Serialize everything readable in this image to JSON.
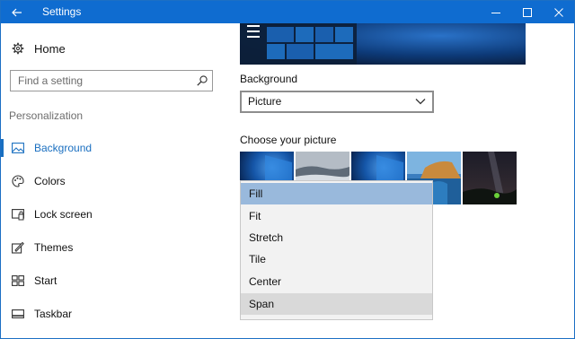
{
  "titlebar": {
    "title": "Settings",
    "back_icon": "back-arrow-icon",
    "minimize_icon": "minimize-icon",
    "maximize_icon": "maximize-icon",
    "close_icon": "close-icon",
    "color": "#0f6cd0"
  },
  "sidebar": {
    "home_label": "Home",
    "search_placeholder": "Find a setting",
    "section_label": "Personalization",
    "items": [
      {
        "label": "Background",
        "icon": "picture-icon",
        "active": true
      },
      {
        "label": "Colors",
        "icon": "palette-icon",
        "active": false
      },
      {
        "label": "Lock screen",
        "icon": "lock-screen-icon",
        "active": false
      },
      {
        "label": "Themes",
        "icon": "themes-icon",
        "active": false
      },
      {
        "label": "Start",
        "icon": "start-icon",
        "active": false
      },
      {
        "label": "Taskbar",
        "icon": "taskbar-icon",
        "active": false
      }
    ],
    "accent": "#1a6fc0"
  },
  "main": {
    "background_label": "Background",
    "background_value": "Picture",
    "choose_label": "Choose your picture"
  },
  "fit_dropdown": {
    "options": [
      "Fill",
      "Fit",
      "Stretch",
      "Tile",
      "Center",
      "Span"
    ],
    "selected": "Fill",
    "hovered": "Span",
    "selected_color": "#99b9dc"
  }
}
